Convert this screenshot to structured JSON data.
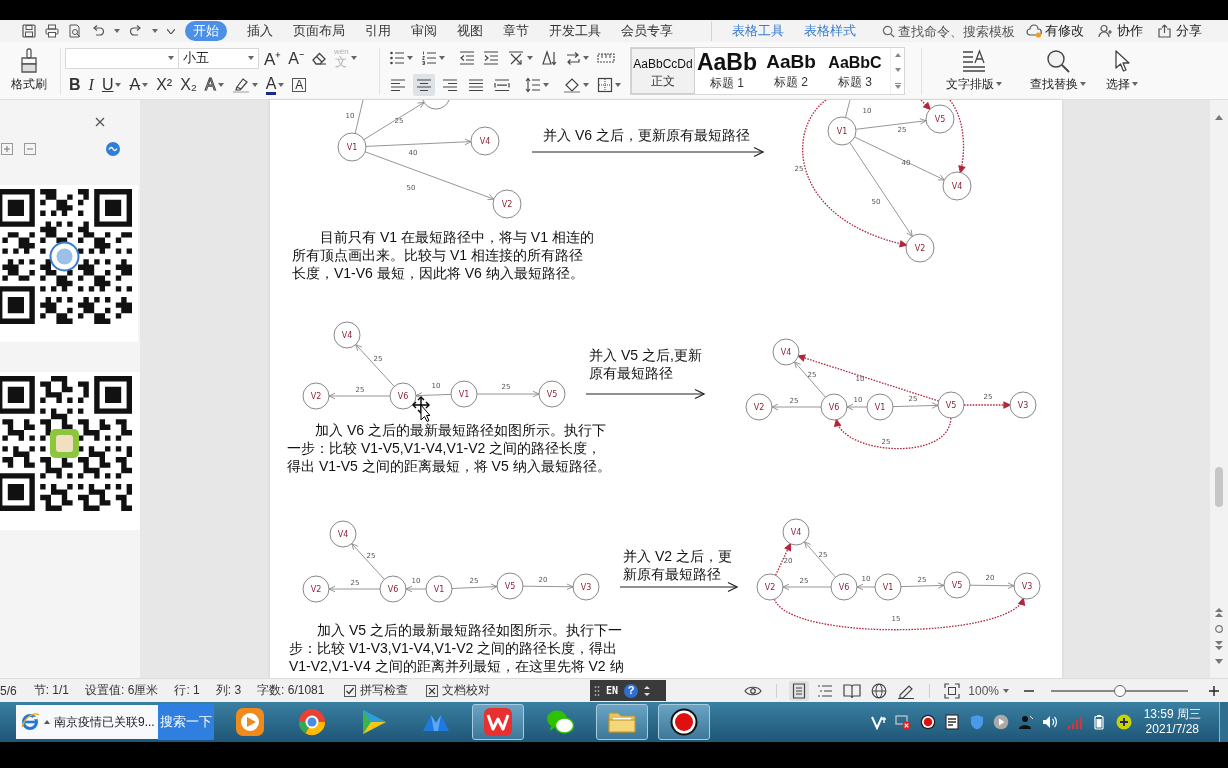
{
  "title_bar": {
    "tabs": [
      {
        "label": "开始",
        "kind": "main",
        "selected": true
      },
      {
        "label": "插入",
        "kind": "main",
        "selected": false
      },
      {
        "label": "页面布局",
        "kind": "main",
        "selected": false
      },
      {
        "label": "引用",
        "kind": "main",
        "selected": false
      },
      {
        "label": "审阅",
        "kind": "main",
        "selected": false
      },
      {
        "label": "视图",
        "kind": "main",
        "selected": false
      },
      {
        "label": "章节",
        "kind": "main",
        "selected": false
      },
      {
        "label": "开发工具",
        "kind": "main",
        "selected": false
      },
      {
        "label": "会员专享",
        "kind": "main",
        "selected": false
      },
      {
        "label": "表格工具",
        "kind": "context",
        "selected": false
      },
      {
        "label": "表格样式",
        "kind": "context",
        "selected": false
      }
    ],
    "search": {
      "placeholder": "查找命令、搜索模板"
    },
    "actions": [
      {
        "kind": "sync",
        "label": "有修改"
      },
      {
        "kind": "collaborate",
        "label": "协作"
      },
      {
        "kind": "share",
        "label": "分享"
      }
    ]
  },
  "ribbon": {
    "format_painter": "格式刷",
    "font_size": "小五",
    "font_tools": [
      {
        "kind": "grow",
        "label": "A⁺"
      },
      {
        "kind": "shrink",
        "label": "A⁻"
      }
    ],
    "phonetic": {
      "label": "文",
      "ruby": "wén",
      "disabled": true
    },
    "format_tools": [
      {
        "kind": "bold",
        "label": "B"
      },
      {
        "kind": "italic",
        "label": "I"
      },
      {
        "kind": "underline",
        "label": "U"
      },
      {
        "kind": "strike",
        "label": "A"
      },
      {
        "kind": "superscript",
        "label": "X²"
      },
      {
        "kind": "subscript",
        "label": "X₂"
      },
      {
        "kind": "effect",
        "label": "A"
      },
      {
        "kind": "color",
        "label": "A"
      },
      {
        "kind": "border",
        "label": "A"
      }
    ],
    "alignment": [
      {
        "kind": "left",
        "selected": false
      },
      {
        "kind": "center",
        "selected": true
      },
      {
        "kind": "right",
        "selected": false
      },
      {
        "kind": "justify",
        "selected": false
      },
      {
        "kind": "distribute",
        "selected": false
      }
    ],
    "styles": [
      {
        "kind": "body",
        "preview": "AaBbCcDd",
        "label": "正文",
        "selected": true
      },
      {
        "kind": "heading1",
        "preview": "AaBb",
        "label": "标题 1",
        "selected": false
      },
      {
        "kind": "heading2",
        "preview": "AaBb",
        "label": "标题 2",
        "selected": false
      },
      {
        "kind": "heading3",
        "preview": "AaBbC",
        "label": "标题 3",
        "selected": false
      }
    ],
    "tools": [
      {
        "kind": "layout",
        "label": "文字排版"
      },
      {
        "kind": "find",
        "label": "查找替换"
      },
      {
        "kind": "select",
        "label": "选择"
      }
    ]
  },
  "document": {
    "sections": [
      {
        "left_graph": {
          "nodes": [
            {
              "kind": "vertex",
              "label": "V1"
            },
            {
              "kind": "vertex",
              "label": "V4"
            },
            {
              "kind": "vertex",
              "label": "V2"
            },
            {
              "kind": "clipped"
            }
          ],
          "edges": [
            {
              "label": "10",
              "kind": "solid"
            },
            {
              "label": "25",
              "kind": "solid"
            },
            {
              "label": "40",
              "kind": "solid"
            },
            {
              "label": "50",
              "kind": "solid"
            }
          ]
        },
        "caption": "并入 V6 之后，更新原有最短路径",
        "right_graph": {
          "nodes": [
            {
              "kind": "vertex",
              "label": "V1"
            },
            {
              "kind": "vertex",
              "label": "V5"
            },
            {
              "kind": "vertex",
              "label": "V4"
            },
            {
              "kind": "vertex",
              "label": "V2"
            }
          ],
          "edges": [
            {
              "label": "10",
              "kind": "solid"
            },
            {
              "label": "25",
              "kind": "solid"
            },
            {
              "label": "40",
              "kind": "solid"
            },
            {
              "label": "50",
              "kind": "solid"
            },
            {
              "label": "25",
              "kind": "dotted"
            },
            {
              "kind": "dotted"
            },
            {
              "kind": "dotted"
            }
          ]
        },
        "paragraph": "目前只有 V1 在最短路径中，将与 V1 相连的所有顶点画出来。比较与 V1 相连接的所有路径长度，V1-V6 最短，因此将 V6 纳入最短路径。"
      },
      {
        "left_graph": {
          "nodes": [
            {
              "kind": "vertex",
              "label": "V4"
            },
            {
              "kind": "vertex",
              "label": "V2"
            },
            {
              "kind": "vertex",
              "label": "V6"
            },
            {
              "kind": "vertex",
              "label": "V1"
            },
            {
              "kind": "vertex",
              "label": "V5"
            }
          ],
          "edges": [
            {
              "label": "25",
              "kind": "solid"
            },
            {
              "label": "25",
              "kind": "solid"
            },
            {
              "label": "10",
              "kind": "solid"
            },
            {
              "label": "25",
              "kind": "solid"
            }
          ]
        },
        "caption": "并入 V5 之后,更新原有最短路径",
        "right_graph": {
          "nodes": [
            {
              "kind": "vertex",
              "label": "V4"
            },
            {
              "kind": "vertex",
              "label": "V2"
            },
            {
              "kind": "vertex",
              "label": "V6"
            },
            {
              "kind": "vertex",
              "label": "V1"
            },
            {
              "kind": "vertex",
              "label": "V5"
            },
            {
              "kind": "vertex",
              "label": "V3"
            }
          ],
          "edges": [
            {
              "label": "25",
              "kind": "solid"
            },
            {
              "label": "25",
              "kind": "solid"
            },
            {
              "label": "10",
              "kind": "solid"
            },
            {
              "label": "25",
              "kind": "solid"
            },
            {
              "label": "10",
              "kind": "dotted"
            },
            {
              "label": "25",
              "kind": "dotted"
            },
            {
              "label": "25",
              "kind": "dotted"
            }
          ]
        },
        "paragraph": "加入 V6 之后的最新最短路径如图所示。执行下一步：比较 V1-V5,V1-V4,V1-V2 之间的路径长度，得出 V1-V5 之间的距离最短，将 V5 纳入最短路径。"
      },
      {
        "left_graph": {
          "nodes": [
            {
              "kind": "vertex",
              "label": "V4"
            },
            {
              "kind": "vertex",
              "label": "V2"
            },
            {
              "kind": "vertex",
              "label": "V6"
            },
            {
              "kind": "vertex",
              "label": "V1"
            },
            {
              "kind": "vertex",
              "label": "V5"
            },
            {
              "kind": "vertex",
              "label": "V3"
            }
          ],
          "edges": [
            {
              "label": "25",
              "kind": "solid"
            },
            {
              "label": "25",
              "kind": "solid"
            },
            {
              "label": "10",
              "kind": "solid"
            },
            {
              "label": "25",
              "kind": "solid"
            },
            {
              "label": "20",
              "kind": "solid"
            }
          ]
        },
        "caption": "并入 V2 之后，更新原有最短路径",
        "right_graph": {
          "nodes": [
            {
              "kind": "vertex",
              "label": "V4"
            },
            {
              "kind": "vertex",
              "label": "V2"
            },
            {
              "kind": "vertex",
              "label": "V6"
            },
            {
              "kind": "vertex",
              "label": "V1"
            },
            {
              "kind": "vertex",
              "label": "V5"
            },
            {
              "kind": "vertex",
              "label": "V3"
            }
          ],
          "edges": [
            {
              "label": "25",
              "kind": "solid"
            },
            {
              "label": "25",
              "kind": "solid"
            },
            {
              "label": "10",
              "kind": "solid"
            },
            {
              "label": "25",
              "kind": "solid"
            },
            {
              "label": "20",
              "kind": "solid"
            },
            {
              "label": "20",
              "kind": "dotted"
            },
            {
              "label": "15",
              "kind": "dotted"
            }
          ]
        },
        "paragraph": "加入 V5 之后的最新最短路径如图所示。执行下一步：比较 V1-V3,V1-V4,V1-V2 之间的路径长度，得出 V1-V2,V1-V4 之间的距离并列最短，在这里先将 V2 纳"
      }
    ]
  },
  "status_bar": {
    "fields": [
      "5/6",
      "节: 1/1",
      "设置值: 6厘米",
      "行: 1",
      "列: 3",
      "字数: 6/1081"
    ],
    "checks": [
      {
        "kind": "spelling",
        "label": "拼写检查"
      },
      {
        "kind": "proofing",
        "label": "文档校对"
      }
    ],
    "ime": {
      "language": "EN",
      "help": "?"
    },
    "view_modes": [
      {
        "kind": "page",
        "selected": true
      },
      {
        "kind": "outline",
        "selected": false
      },
      {
        "kind": "reading",
        "selected": false
      },
      {
        "kind": "web",
        "selected": false
      }
    ],
    "zoom": {
      "value": "100%",
      "level": 0.5
    }
  },
  "taskbar": {
    "search": {
      "value": "南京疫情已关联9..."
    },
    "search_button": "搜索一下",
    "apps": [
      {
        "kind": "video",
        "active": false
      },
      {
        "kind": "browser",
        "active": false
      },
      {
        "kind": "player",
        "active": false
      },
      {
        "kind": "cloud",
        "active": false
      },
      {
        "kind": "office",
        "active": true
      },
      {
        "kind": "chat",
        "active": false
      },
      {
        "kind": "folder",
        "active": true
      },
      {
        "kind": "recorder",
        "active": true
      }
    ],
    "clock": {
      "time": "13:59 周三",
      "date": "2021/7/28"
    }
  }
}
